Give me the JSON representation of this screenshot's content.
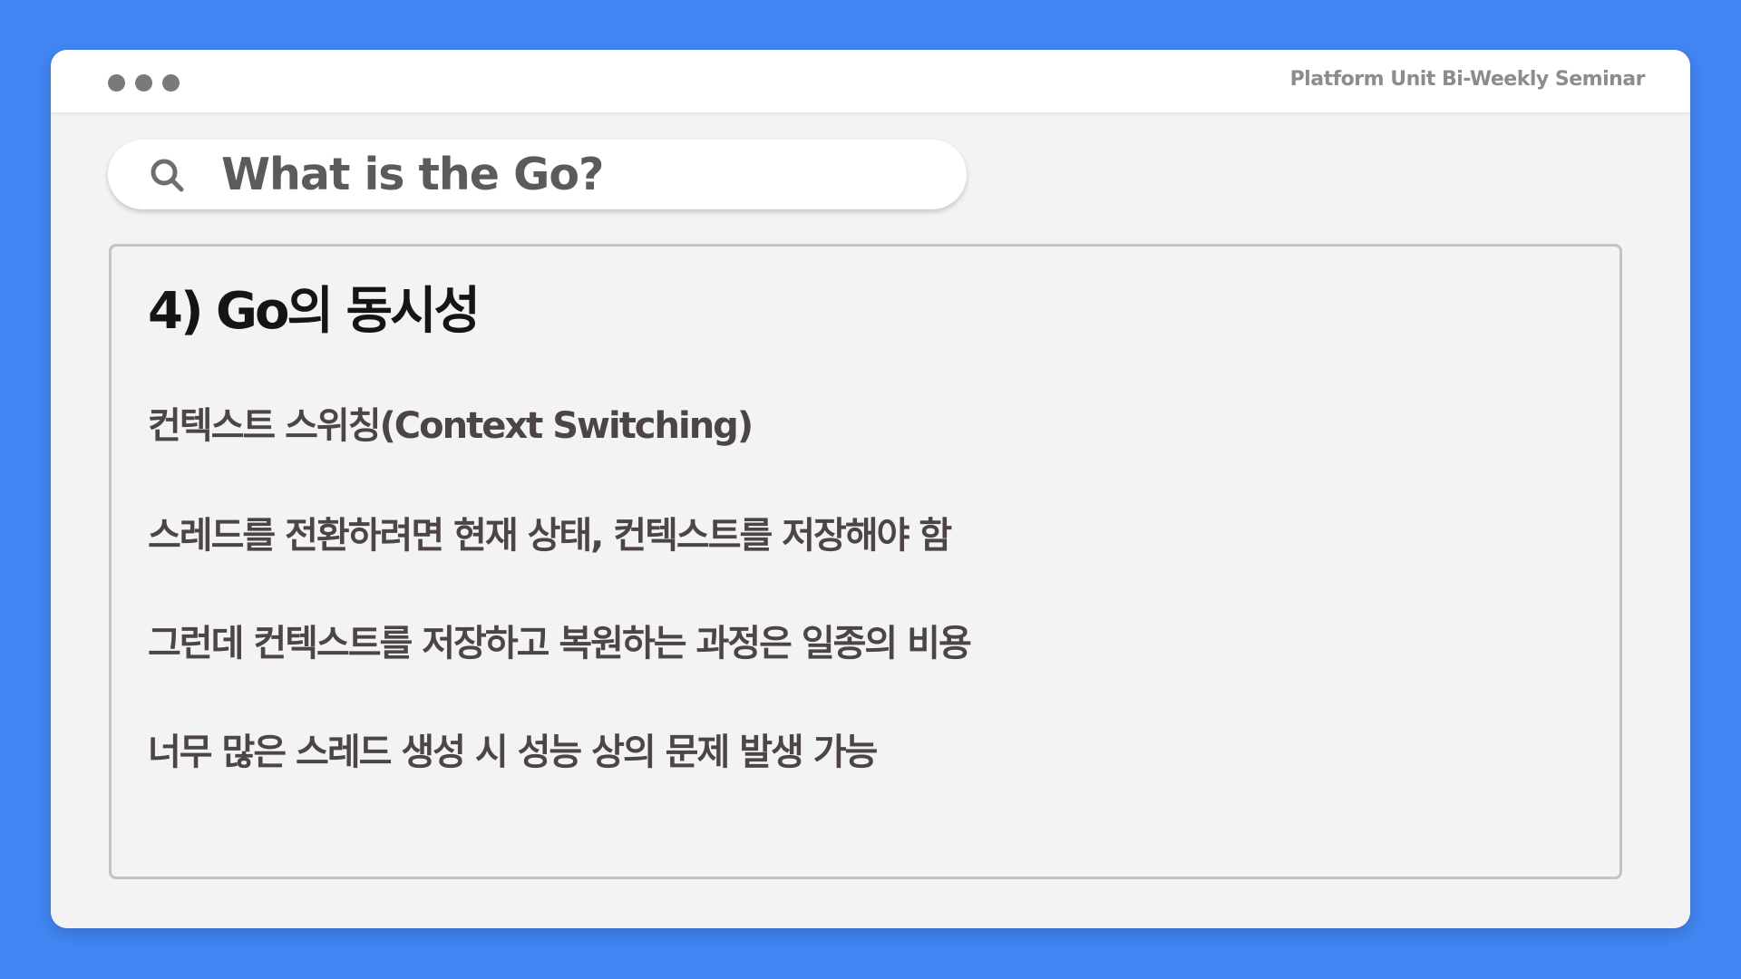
{
  "titlebar": {
    "seminar_title": "Platform Unit Bi-Weekly Seminar"
  },
  "search": {
    "query": "What is the Go?",
    "icon": "search-icon"
  },
  "slide": {
    "heading": "4) Go의 동시성",
    "bullets": [
      "컨텍스트 스위칭(Context Switching)",
      "스레드를 전환하려면 현재 상태, 컨텍스트를 저장해야 함",
      "그런데 컨텍스트를 저장하고 복원하는 과정은 일종의 비용",
      "너무 많은 스레드 생성 시 성능 상의 문제 발생 가능"
    ]
  },
  "colors": {
    "background": "#4286f4",
    "window": "#f3f3f3",
    "titlebar": "#ffffff",
    "text_dark": "#151515",
    "text_body": "#4d4545",
    "text_muted": "#8c8c8c"
  }
}
